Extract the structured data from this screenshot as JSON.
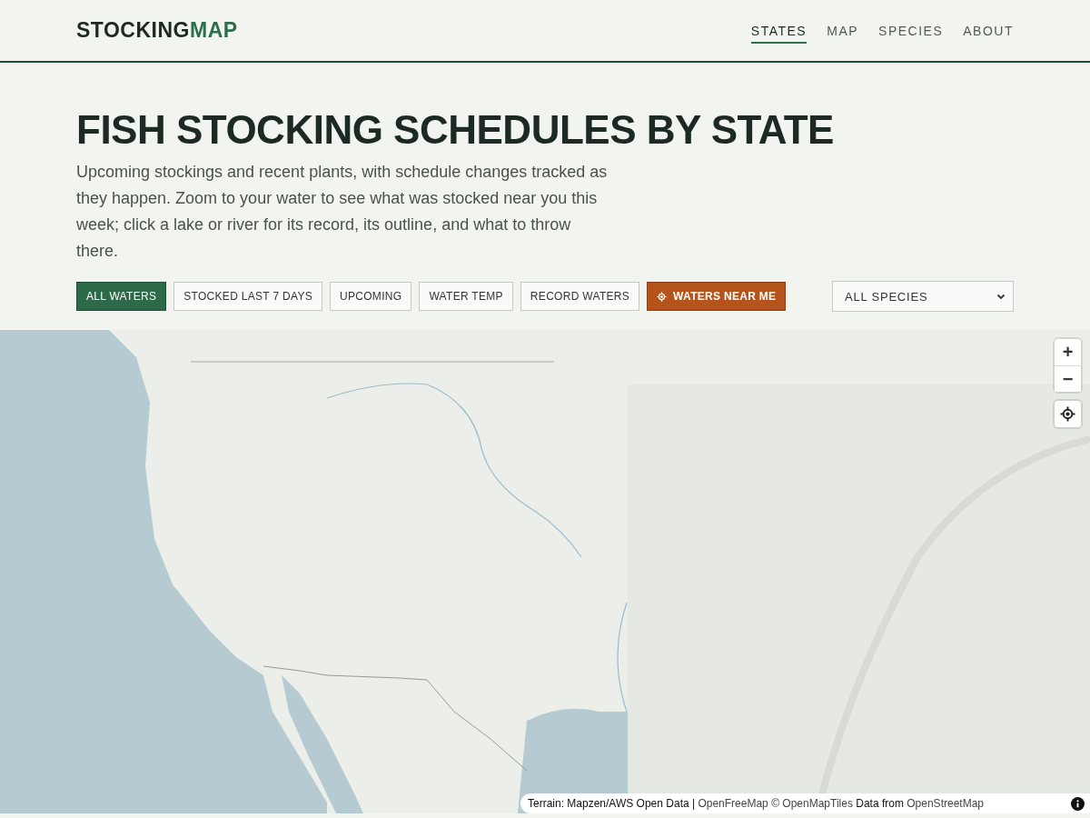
{
  "header": {
    "logo": {
      "part_1": "STOCKING",
      "part_2": "MAP"
    },
    "nav": [
      {
        "label": "STATES",
        "selected": true
      },
      {
        "label": "MAP",
        "selected": false
      },
      {
        "label": "SPECIES",
        "selected": false
      },
      {
        "label": "ABOUT",
        "selected": false
      }
    ]
  },
  "hero": {
    "title": "FISH STOCKING SCHEDULES BY STATE",
    "description": "Upcoming stockings and recent plants, with schedule changes tracked as they happen. Zoom to your water to see what was stocked near you this week; click a lake or river for its record, its outline, and what to throw there."
  },
  "filters": [
    {
      "label": "ALL WATERS",
      "selected": true,
      "kind": "filter"
    },
    {
      "label": "STOCKED LAST 7 DAYS",
      "selected": false,
      "kind": "filter"
    },
    {
      "label": "UPCOMING",
      "selected": false,
      "kind": "filter"
    },
    {
      "label": "WATER TEMP",
      "selected": false,
      "kind": "filter"
    },
    {
      "label": "RECORD WATERS",
      "selected": false,
      "kind": "filter"
    },
    {
      "label": "WATERS NEAR ME",
      "selected": false,
      "kind": "locate"
    }
  ],
  "species_select": {
    "value": "ALL SPECIES"
  },
  "map": {
    "controls": [
      {
        "label": "+",
        "kind": "zoom-in"
      },
      {
        "label": "−",
        "kind": "zoom-out"
      },
      {
        "kind": "locate"
      }
    ],
    "attribution": [
      {
        "kind": "text",
        "text": "Terrain: Mapzen/AWS Open Data | "
      },
      {
        "kind": "link",
        "text": "OpenFreeMap"
      },
      {
        "kind": "link",
        "text": " © OpenMapTiles"
      },
      {
        "kind": "text",
        "text": " Data from "
      },
      {
        "kind": "link",
        "text": "OpenStreetMap"
      }
    ]
  }
}
